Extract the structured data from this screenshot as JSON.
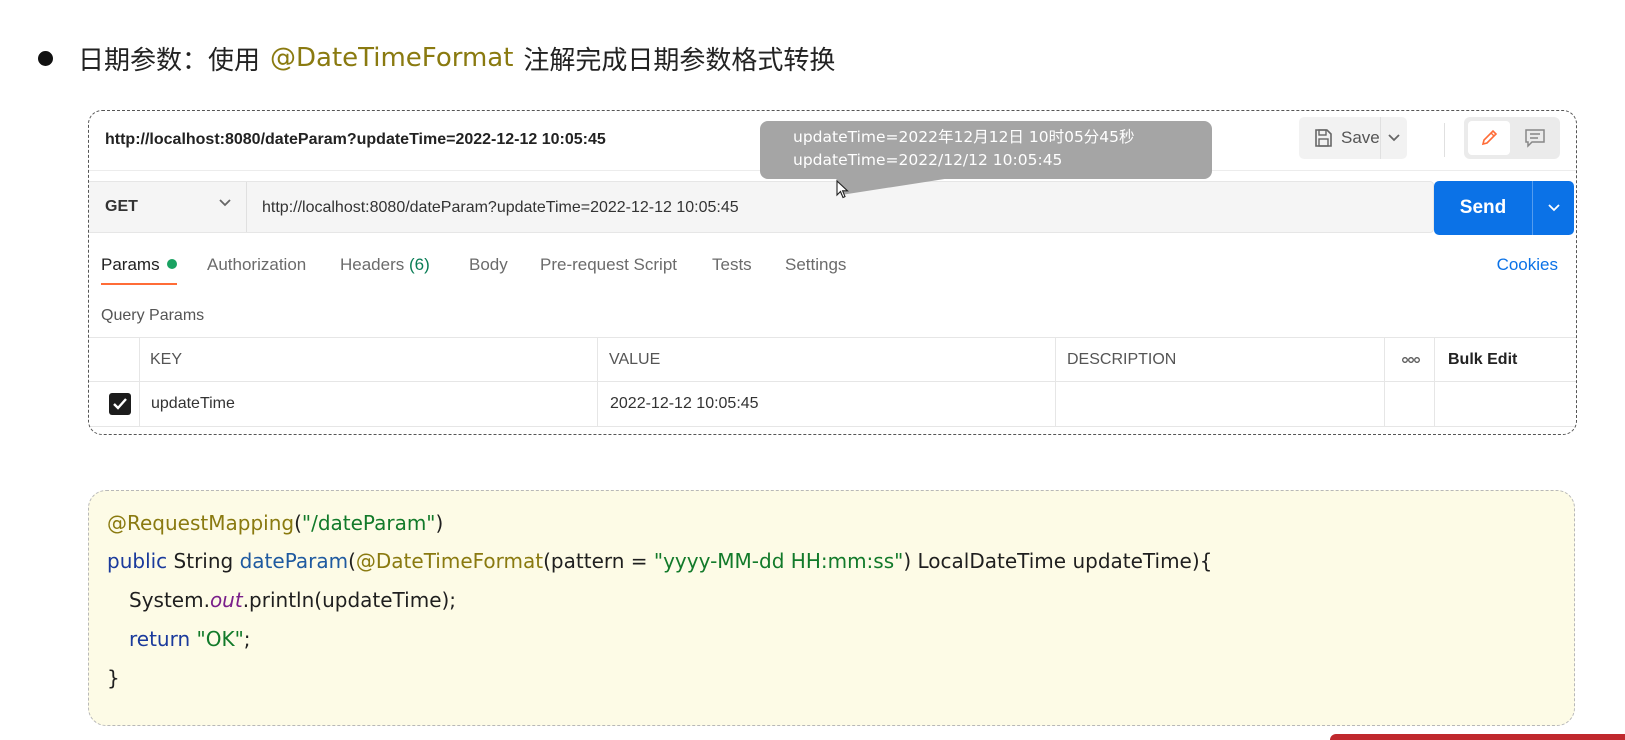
{
  "heading": {
    "prefix": "日期参数：使用",
    "annotation": "@DateTimeFormat",
    "suffix": "注解完成日期参数格式转换"
  },
  "postman": {
    "title_url": "http://localhost:8080/dateParam?updateTime=2022-12-12 10:05:45",
    "save_label": "Save",
    "method": "GET",
    "request_url": "http://localhost:8080/dateParam?updateTime=2022-12-12 10:05:45",
    "send_label": "Send",
    "tabs": {
      "params": "Params",
      "authorization": "Authorization",
      "headers": "Headers",
      "headers_count": "(6)",
      "body": "Body",
      "prerequest": "Pre-request Script",
      "tests": "Tests",
      "settings": "Settings"
    },
    "cookies_label": "Cookies",
    "query_params_label": "Query Params",
    "table": {
      "headers": {
        "key": "KEY",
        "value": "VALUE",
        "description": "DESCRIPTION",
        "bulk_edit": "Bulk Edit"
      },
      "rows": [
        {
          "key": "updateTime",
          "value": "2022-12-12 10:05:45",
          "description": "",
          "checked": true
        }
      ]
    }
  },
  "tooltip": {
    "line1": "updateTime=2022年12月12日 10时05分45秒",
    "line2": "updateTime=2022/12/12 10:05:45"
  },
  "code": {
    "line1": {
      "annotation": "@RequestMapping",
      "open": "(",
      "path": "\"/dateParam\"",
      "close": ")"
    },
    "line2": {
      "kw": "public",
      "type": " String ",
      "method": "dateParam",
      "open": "(",
      "annotation": "@DateTimeFormat",
      "param_open": "(pattern = ",
      "pattern": "\"yyyy-MM-dd HH:mm:ss\"",
      "rest": ") LocalDateTime updateTime){"
    },
    "line3": {
      "obj": "System.",
      "field": "out",
      "call": ".println(updateTime);"
    },
    "line4": {
      "kw": "return",
      "value": "\"OK\"",
      "end": ";"
    },
    "line5": "}"
  },
  "colors": {
    "send_blue": "#0b72e7",
    "active_tab_orange": "#ff6c37",
    "active_dot_green": "#1aa262",
    "annotation_olive": "#8a7a10",
    "code_bg": "#fdfbe6",
    "tooltip_gray": "#a5a5a5",
    "accent_red": "#c0282d"
  }
}
